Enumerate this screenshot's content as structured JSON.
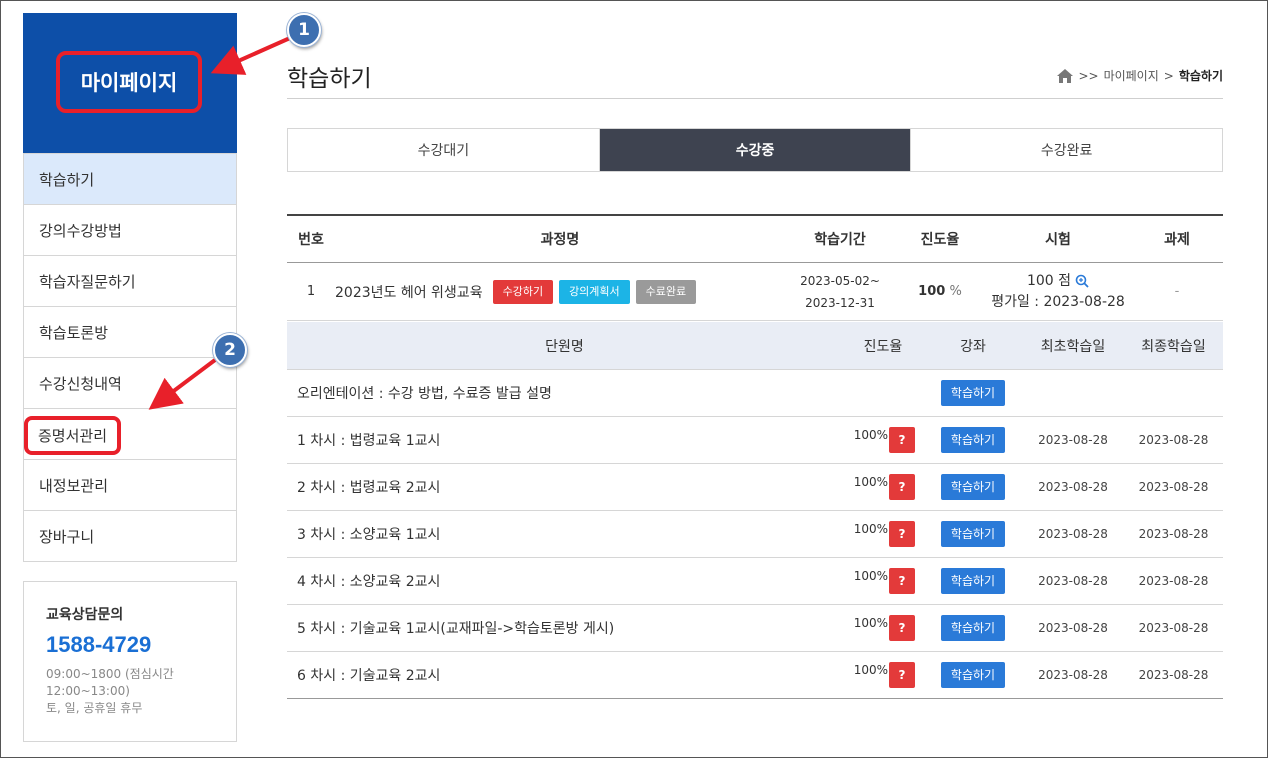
{
  "sidebar": {
    "title": "마이페이지",
    "items": [
      {
        "label": "학습하기"
      },
      {
        "label": "강의수강방법"
      },
      {
        "label": "학습자질문하기"
      },
      {
        "label": "학습토론방"
      },
      {
        "label": "수강신청내역"
      },
      {
        "label": "증명서관리"
      },
      {
        "label": "내정보관리"
      },
      {
        "label": "장바구니"
      }
    ],
    "contact": {
      "title": "교육상담문의",
      "phone": "1588-4729",
      "hours": "09:00~1800 (점심시간 12:00~13:00)",
      "holiday": "토, 일, 공휴일 휴무"
    }
  },
  "annotations": {
    "badge1": "1",
    "badge2": "2"
  },
  "page": {
    "title": "학습하기",
    "breadcrumb": {
      "sep1": ">>",
      "parent": "마이페이지",
      "sep2": ">",
      "current": "학습하기"
    }
  },
  "tabs": [
    {
      "label": "수강대기"
    },
    {
      "label": "수강중"
    },
    {
      "label": "수강완료"
    }
  ],
  "course_table": {
    "headers": {
      "no": "번호",
      "name": "과정명",
      "period": "학습기간",
      "progress": "진도율",
      "exam": "시험",
      "task": "과제"
    },
    "row": {
      "no": "1",
      "name": "2023년도 헤어 위생교육",
      "btn_study": "수강하기",
      "btn_plan": "강의계획서",
      "btn_done": "수료완료",
      "period_start": "2023-05-02~",
      "period_end": "2023-12-31",
      "progress_value": "100",
      "progress_unit": "%",
      "exam_score": "100 점",
      "exam_date": "평가일 : 2023-08-28",
      "task": "-"
    }
  },
  "unit_table": {
    "headers": {
      "name": "단원명",
      "progress": "진도율",
      "lecture": "강좌",
      "first": "최초학습일",
      "last": "최종학습일"
    },
    "rows": [
      {
        "name": "오리엔테이션 :  수강 방법, 수료증 발급 설명",
        "progress": "",
        "quiz": "",
        "lecture": "학습하기",
        "first": "",
        "last": ""
      },
      {
        "name": "1 차시 :  법령교육 1교시",
        "progress": "100%",
        "quiz": "?",
        "lecture": "학습하기",
        "first": "2023-08-28",
        "last": "2023-08-28"
      },
      {
        "name": "2 차시 :  법령교육 2교시",
        "progress": "100%",
        "quiz": "?",
        "lecture": "학습하기",
        "first": "2023-08-28",
        "last": "2023-08-28"
      },
      {
        "name": "3 차시 :  소양교육 1교시",
        "progress": "100%",
        "quiz": "?",
        "lecture": "학습하기",
        "first": "2023-08-28",
        "last": "2023-08-28"
      },
      {
        "name": "4 차시 :  소양교육 2교시",
        "progress": "100%",
        "quiz": "?",
        "lecture": "학습하기",
        "first": "2023-08-28",
        "last": "2023-08-28"
      },
      {
        "name": "5 차시 :  기술교육 1교시(교재파일->학습토론방 게시)",
        "progress": "100%",
        "quiz": "?",
        "lecture": "학습하기",
        "first": "2023-08-28",
        "last": "2023-08-28"
      },
      {
        "name": "6 차시 :  기술교육 2교시",
        "progress": "100%",
        "quiz": "?",
        "lecture": "학습하기",
        "first": "2023-08-28",
        "last": "2023-08-28"
      }
    ]
  },
  "colors": {
    "brand_blue": "#0d4fa8",
    "active_tab": "#3e4350",
    "highlight_red": "#e8202a",
    "button_blue": "#2a7ad8"
  }
}
